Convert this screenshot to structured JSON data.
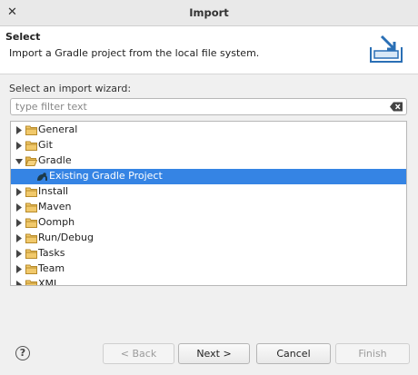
{
  "window": {
    "title": "Import",
    "close_glyph": "✕"
  },
  "header": {
    "title": "Select",
    "description": "Import a Gradle project from the local file system."
  },
  "wizard": {
    "label": "Select an import wizard:",
    "filter_placeholder": "type filter text",
    "filter_value": ""
  },
  "tree": {
    "items": [
      {
        "label": "General",
        "expanded": false
      },
      {
        "label": "Git",
        "expanded": false
      },
      {
        "label": "Gradle",
        "expanded": true
      },
      {
        "label": "Existing Gradle Project",
        "child": true,
        "selected": true
      },
      {
        "label": "Install",
        "expanded": false
      },
      {
        "label": "Maven",
        "expanded": false
      },
      {
        "label": "Oomph",
        "expanded": false
      },
      {
        "label": "Run/Debug",
        "expanded": false
      },
      {
        "label": "Tasks",
        "expanded": false
      },
      {
        "label": "Team",
        "expanded": false
      },
      {
        "label": "XML",
        "expanded": false
      }
    ]
  },
  "buttons": {
    "help": "?",
    "back": "< Back",
    "next": "Next >",
    "cancel": "Cancel",
    "finish": "Finish"
  },
  "colors": {
    "selection": "#3584e4",
    "folder": "#e8b04a",
    "accent": "#2a6fb5"
  }
}
